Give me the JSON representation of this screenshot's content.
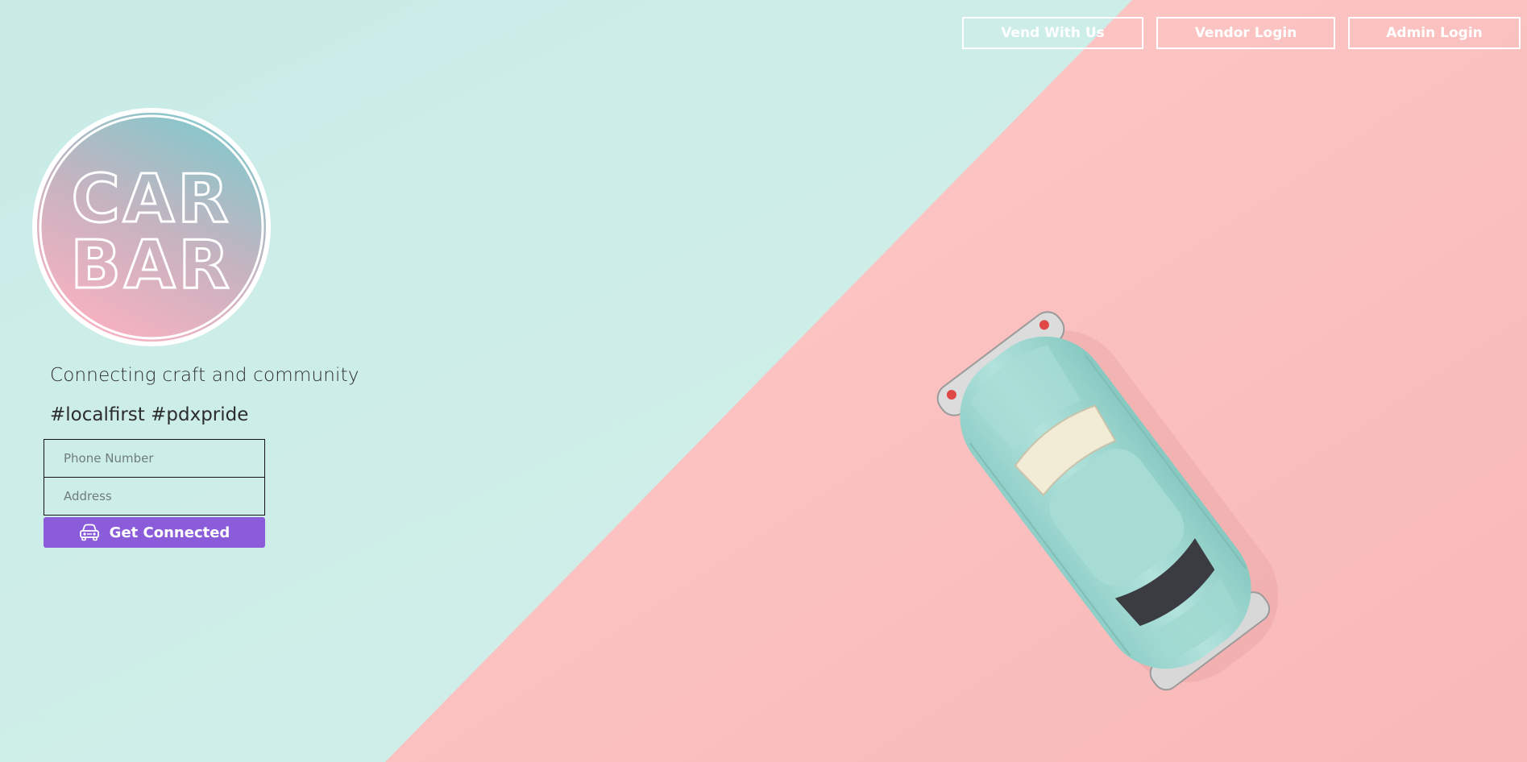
{
  "nav": {
    "vend_label": "Vend With Us",
    "vendor_login_label": "Vendor Login",
    "admin_login_label": "Admin Login"
  },
  "logo": {
    "line1": "CAR",
    "line2": "BAR"
  },
  "hero": {
    "tagline": "Connecting craft and community",
    "hashtags": "#localfirst #pdxpride"
  },
  "form": {
    "phone_placeholder": "Phone Number",
    "address_placeholder": "Address",
    "submit_label": "Get Connected",
    "submit_icon": "car-icon"
  },
  "colors": {
    "mint_background": "#cdece8",
    "pink_background": "#fcc3c2",
    "button_purple": "#8a5cd9",
    "toy_car_teal": "#9cd6cf"
  }
}
